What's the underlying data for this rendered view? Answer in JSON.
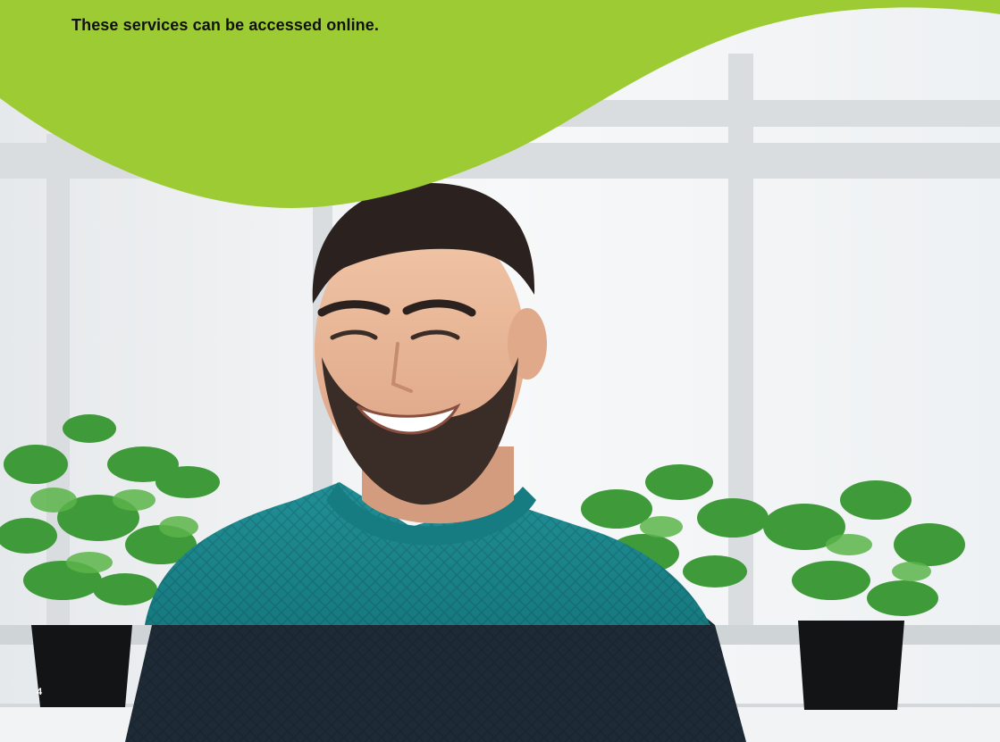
{
  "page": {
    "headline": "These services can be accessed online.",
    "page_number": "4"
  },
  "colors": {
    "brand_green": "#9ccb34",
    "sweater_teal": "#1b8b92",
    "sweater_navy": "#1e2a36"
  },
  "photo": {
    "subject": "smiling man in teal and navy cable-knit sweater by a window with potted herbs"
  }
}
